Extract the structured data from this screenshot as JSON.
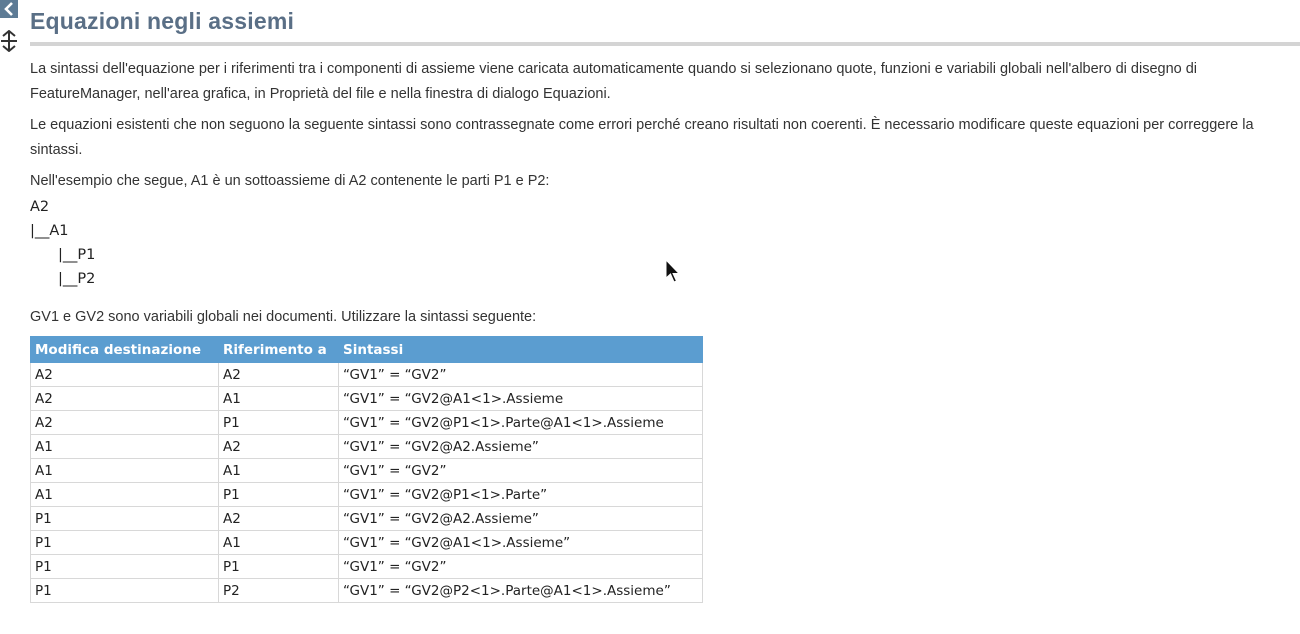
{
  "page": {
    "title": "Equazioni negli assiemi"
  },
  "toolbar": {
    "back_icon": "chevron-left-icon",
    "move_icon": "move-arrows-icon"
  },
  "intro": {
    "paragraph1": "La sintassi dell'equazione per i riferimenti tra i componenti di assieme viene caricata automaticamente quando si selezionano quote, funzioni e variabili globali nell'albero di disegno di FeatureManager, nell'area grafica, in Proprietà del file e nella finestra di dialogo Equazioni.",
    "paragraph2": "Le equazioni esistenti che non seguono la seguente sintassi sono contrassegnate come errori perché creano risultati non coerenti. È necessario modificare queste equazioni per correggere la sintassi.",
    "paragraph3": "Nell'esempio che segue, A1 è un sottoassieme di A2 contenente le parti P1 e P2:"
  },
  "tree": {
    "root": "A2",
    "level1": "|__A1",
    "level2a": "|__P1",
    "level2b": "|__P2"
  },
  "note": "GV1 e GV2 sono variabili globali nei documenti. Utilizzare la sintassi seguente:",
  "table": {
    "headers": [
      "Modifica destinazione",
      "Riferimento a",
      "Sintassi"
    ],
    "rows": [
      [
        "A2",
        "A2",
        "“GV1” = “GV2”"
      ],
      [
        "A2",
        "A1",
        "“GV1” = “GV2@A1<1>.Assieme"
      ],
      [
        "A2",
        "P1",
        "“GV1” = “GV2@P1<1>.Parte@A1<1>.Assieme"
      ],
      [
        "A1",
        "A2",
        "“GV1” = “GV2@A2.Assieme”"
      ],
      [
        "A1",
        "A1",
        "“GV1” = “GV2”"
      ],
      [
        "A1",
        "P1",
        "“GV1” = “GV2@P1<1>.Parte”"
      ],
      [
        "P1",
        "A2",
        "“GV1” = “GV2@A2.Assieme”"
      ],
      [
        "P1",
        "A1",
        "“GV1” = “GV2@A1<1>.Assieme”"
      ],
      [
        "P1",
        "P1",
        "“GV1” = “GV2”"
      ],
      [
        "P1",
        "P2",
        "“GV1” = “GV2@P2<1>.Parte@A1<1>.Assieme”"
      ]
    ]
  },
  "colors": {
    "title": "#5a6f86",
    "table_header": "#5b9dd0",
    "rule": "#d4d4d4"
  }
}
